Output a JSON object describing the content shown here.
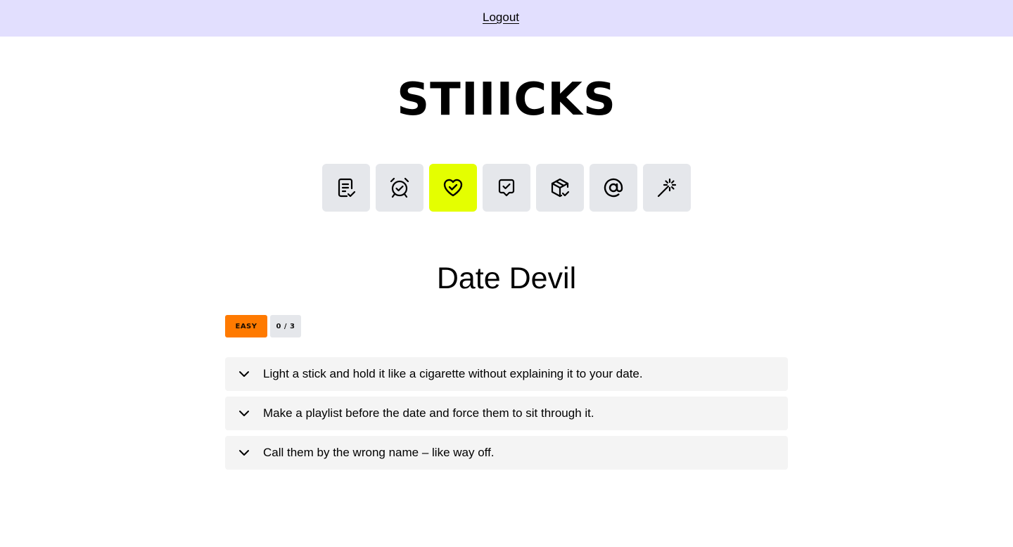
{
  "header": {
    "logout_label": "Logout"
  },
  "brand": {
    "logo_text": "STIIICKS"
  },
  "categories": [
    {
      "icon": "checklist-note-icon",
      "active": false
    },
    {
      "icon": "alarm-clock-check-icon",
      "active": false
    },
    {
      "icon": "heart-check-icon",
      "active": true
    },
    {
      "icon": "message-check-icon",
      "active": false
    },
    {
      "icon": "package-check-icon",
      "active": false
    },
    {
      "icon": "at-sign-icon",
      "active": false
    },
    {
      "icon": "magic-wand-icon",
      "active": false
    }
  ],
  "colors": {
    "topbar": "#e2dffe",
    "active_category": "#e4ff00",
    "level_badge": "#ff7a00",
    "tile": "#e5e7eb",
    "item_bg": "#f4f4f4"
  },
  "challenge": {
    "title": "Date Devil",
    "level": "EASY",
    "progress": "0 / 3",
    "items": [
      {
        "text": "Light a stick and hold it like a cigarette without explaining it to your date."
      },
      {
        "text": "Make a playlist before the date and force them to sit through it."
      },
      {
        "text": "Call them by the wrong name – like way off."
      }
    ]
  }
}
